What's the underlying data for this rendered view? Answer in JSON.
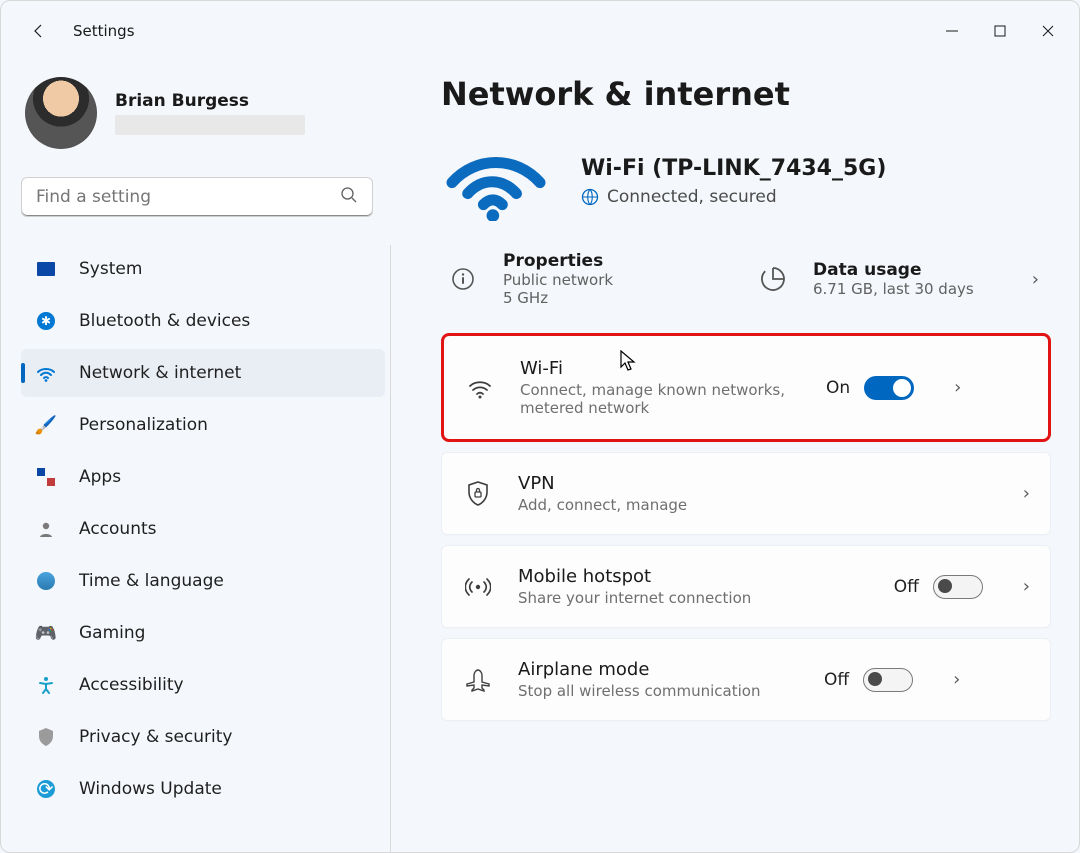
{
  "titlebar": {
    "app_title": "Settings"
  },
  "profile": {
    "name": "Brian Burgess"
  },
  "search": {
    "placeholder": "Find a setting"
  },
  "sidebar": {
    "items": [
      {
        "icon": "system",
        "label": "System"
      },
      {
        "icon": "bluetooth",
        "label": "Bluetooth & devices"
      },
      {
        "icon": "network",
        "label": "Network & internet",
        "selected": true
      },
      {
        "icon": "personalization",
        "label": "Personalization"
      },
      {
        "icon": "apps",
        "label": "Apps"
      },
      {
        "icon": "accounts",
        "label": "Accounts"
      },
      {
        "icon": "time",
        "label": "Time & language"
      },
      {
        "icon": "gaming",
        "label": "Gaming"
      },
      {
        "icon": "accessibility",
        "label": "Accessibility"
      },
      {
        "icon": "privacy",
        "label": "Privacy & security"
      },
      {
        "icon": "windows-update",
        "label": "Windows Update"
      }
    ]
  },
  "main": {
    "page_title": "Network & internet",
    "hero": {
      "title": "Wi-Fi (TP-LINK_7434_5G)",
      "status": "Connected, secured"
    },
    "info": {
      "properties": {
        "title": "Properties",
        "line1": "Public network",
        "line2": "5 GHz"
      },
      "data_usage": {
        "title": "Data usage",
        "line1": "6.71 GB, last 30 days"
      }
    },
    "cards": {
      "wifi": {
        "title": "Wi-Fi",
        "sub": "Connect, manage known networks, metered network",
        "toggle": "On"
      },
      "vpn": {
        "title": "VPN",
        "sub": "Add, connect, manage"
      },
      "hotspot": {
        "title": "Mobile hotspot",
        "sub": "Share your internet connection",
        "toggle": "Off"
      },
      "airplane": {
        "title": "Airplane mode",
        "sub": "Stop all wireless communication",
        "toggle": "Off"
      }
    }
  }
}
